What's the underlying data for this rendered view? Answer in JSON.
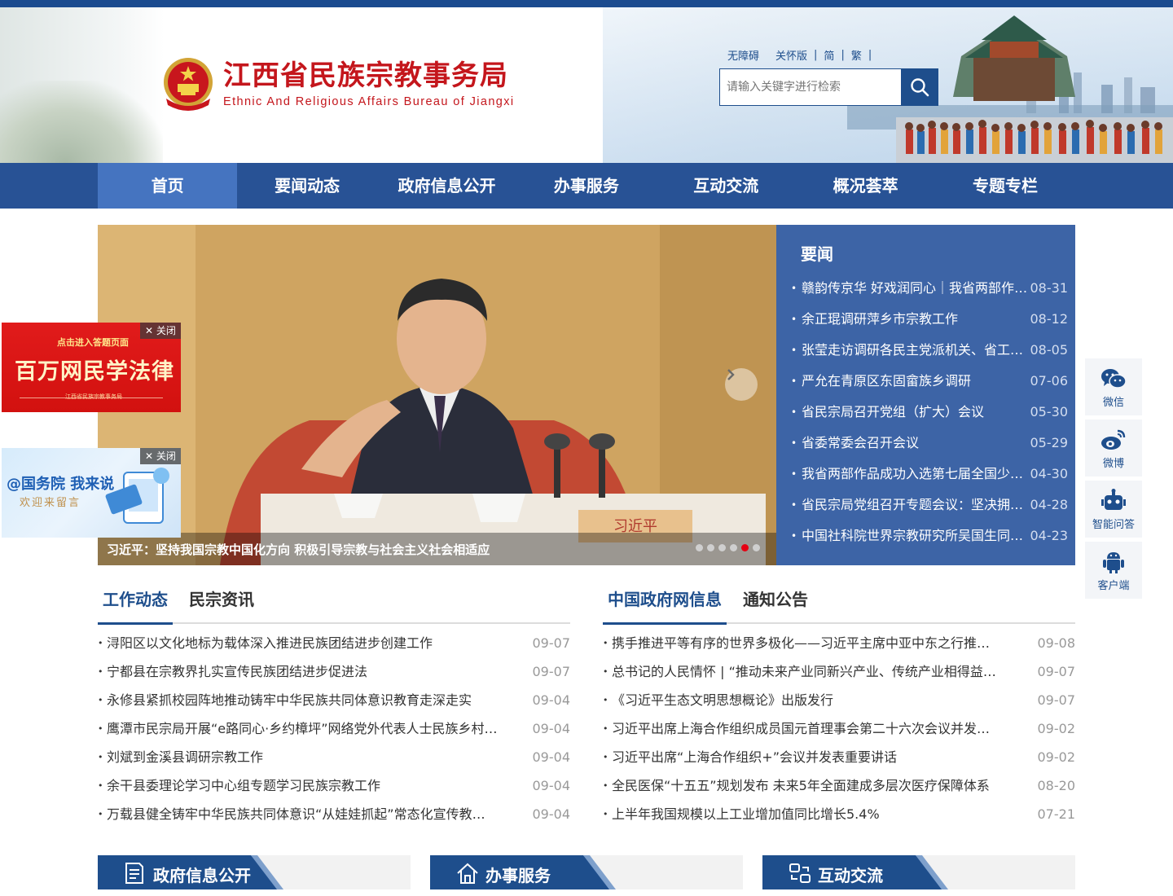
{
  "header": {
    "title_cn": "江西省民族宗教事务局",
    "title_en": "Ethnic And Religious Affairs Bureau of Jiangxi",
    "links": [
      "无障碍",
      "关怀版",
      "简",
      "繁"
    ],
    "search_placeholder": "请输入关键字进行检索"
  },
  "nav": {
    "items": [
      "首页",
      "要闻动态",
      "政府信息公开",
      "办事服务",
      "互动交流",
      "概况荟萃",
      "专题专栏"
    ],
    "active": "首页"
  },
  "slider": {
    "caption": "习近平：坚持我国宗教中国化方向 积极引导宗教与社会主义社会相适应",
    "total_slides": 6,
    "active_slide": 5,
    "nameplate": "习近平"
  },
  "headlines": {
    "title": "要闻",
    "items": [
      {
        "title": "赣韵传京华 好戏润同心｜我省两部作品成功入选第七届全国少数民族文艺会演",
        "date": "08-31"
      },
      {
        "title": "余正琨调研萍乡市宗教工作",
        "date": "08-12"
      },
      {
        "title": "张莹走访调研各民主党派机关、省工商联",
        "date": "08-05"
      },
      {
        "title": "严允在青原区东固畲族乡调研",
        "date": "07-06"
      },
      {
        "title": "省民宗局召开党组（扩大）会议",
        "date": "05-30"
      },
      {
        "title": "省委常委会召开会议",
        "date": "05-29"
      },
      {
        "title": "我省两部作品成功入选第七届全国少数民族文艺会演",
        "date": "04-30"
      },
      {
        "title": "省民宗局党组召开专题会议：坚决拥护党中央决定",
        "date": "04-28"
      },
      {
        "title": "中国社科院世界宗教研究所吴国生同志来赣调研",
        "date": "04-23"
      }
    ]
  },
  "ads": {
    "law": {
      "line1": "点击进入答题页面",
      "line2": "百万网民学法律",
      "line3": "江西省民族宗教事务局",
      "close": "关闭"
    },
    "council": {
      "line1": "@国务院 我来说",
      "line2": "欢迎来留言",
      "close": "关闭"
    }
  },
  "side_tools": [
    {
      "label": "微信",
      "icon": "wechat-icon"
    },
    {
      "label": "微博",
      "icon": "weibo-icon"
    },
    {
      "label": "智能问答",
      "icon": "robot-icon"
    },
    {
      "label": "客户端",
      "icon": "android-icon"
    }
  ],
  "panel_left": {
    "tabs": [
      "工作动态",
      "民宗资讯"
    ],
    "active_tab": "工作动态",
    "items": [
      {
        "title": "浔阳区以文化地标为载体深入推进民族团结进步创建工作",
        "date": "09-07"
      },
      {
        "title": "宁都县在宗教界扎实宣传民族团结进步促进法",
        "date": "09-07"
      },
      {
        "title": "永修县紧抓校园阵地推动铸牢中华民族共同体意识教育走深走实",
        "date": "09-04"
      },
      {
        "title": "鹰潭市民宗局开展“e路同心·乡约樟坪”网络党外代表人士民族乡村行活动",
        "date": "09-04"
      },
      {
        "title": "刘斌到金溪县调研宗教工作",
        "date": "09-04"
      },
      {
        "title": "余干县委理论学习中心组专题学习民族宗教工作",
        "date": "09-04"
      },
      {
        "title": "万载县健全铸牢中华民族共同体意识“从娃娃抓起”常态化宣传教育机制",
        "date": "09-04"
      }
    ]
  },
  "panel_right": {
    "tabs": [
      "中国政府网信息",
      "通知公告"
    ],
    "active_tab": "中国政府网信息",
    "items": [
      {
        "title": "携手推进平等有序的世界多极化——习近平主席中亚中东之行推动构建人类命运共同体",
        "date": "09-08"
      },
      {
        "title": "总书记的人民情怀 | “推动未来产业同新兴产业、传统产业相得益彰”",
        "date": "09-07"
      },
      {
        "title": "《习近平生态文明思想概论》出版发行",
        "date": "09-07"
      },
      {
        "title": "习近平出席上海合作组织成员国元首理事会第二十六次会议并发表重要讲话",
        "date": "09-02"
      },
      {
        "title": "习近平出席“上海合作组织+”会议并发表重要讲话",
        "date": "09-02"
      },
      {
        "title": "全民医保“十五五”规划发布 未来5年全面建成多层次医疗保障体系",
        "date": "08-20"
      },
      {
        "title": "上半年我国规模以上工业增加值同比增长5.4%",
        "date": "07-21"
      }
    ]
  },
  "sections": [
    {
      "title": "政府信息公开",
      "icon": "document-icon"
    },
    {
      "title": "办事服务",
      "icon": "home-icon"
    },
    {
      "title": "互动交流",
      "icon": "exchange-icon"
    }
  ],
  "colors": {
    "primary": "#1e4e8c",
    "nav": "#285295",
    "nav_active": "#4574c0",
    "brand_red": "#c4161c",
    "news_bg": "#3d64a6"
  }
}
